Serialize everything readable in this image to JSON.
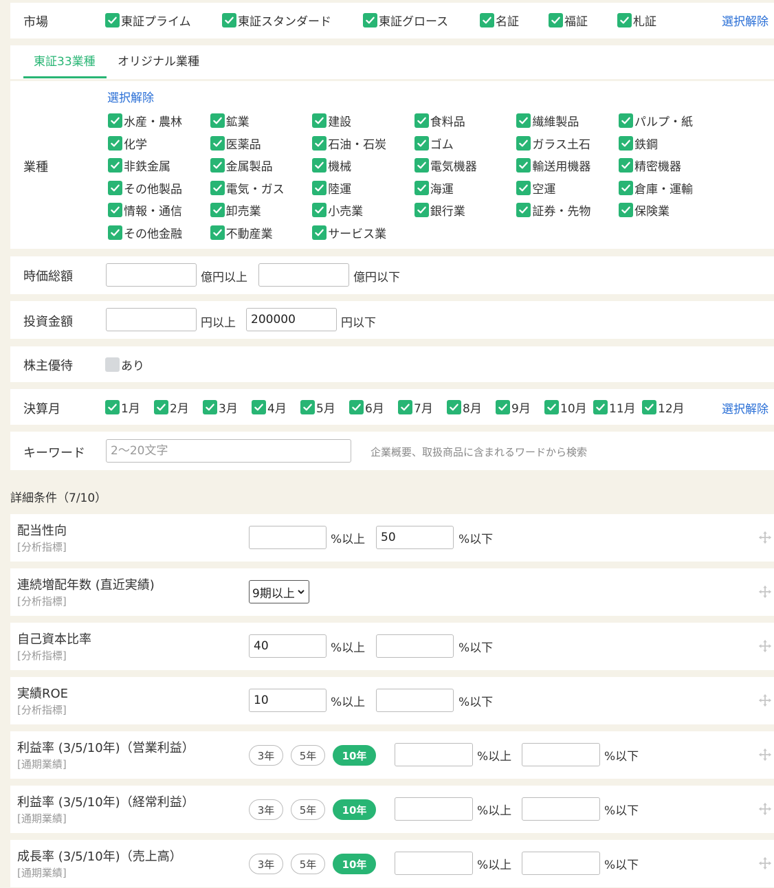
{
  "market": {
    "label": "市場",
    "items": [
      "東証プライム",
      "東証スタンダード",
      "東証グロース",
      "名証",
      "福証",
      "札証"
    ],
    "clear": "選択解除"
  },
  "tabs": [
    "東証33業種",
    "オリジナル業種"
  ],
  "industry": {
    "label": "業種",
    "clear": "選択解除",
    "items": [
      "水産・農林",
      "鉱業",
      "建設",
      "食料品",
      "繊維製品",
      "パルプ・紙",
      "化学",
      "医薬品",
      "石油・石炭",
      "ゴム",
      "ガラス土石",
      "鉄鋼",
      "非鉄金属",
      "金属製品",
      "機械",
      "電気機器",
      "輸送用機器",
      "精密機器",
      "その他製品",
      "電気・ガス",
      "陸運",
      "海運",
      "空運",
      "倉庫・運輸",
      "情報・通信",
      "卸売業",
      "小売業",
      "銀行業",
      "証券・先物",
      "保険業",
      "その他金融",
      "不動産業",
      "サービス業"
    ]
  },
  "market_cap": {
    "label": "時価総額",
    "min_value": "",
    "min_unit": "億円以上",
    "max_value": "",
    "max_unit": "億円以下"
  },
  "investment": {
    "label": "投資金額",
    "min_value": "",
    "min_unit": "円以上",
    "max_value": "200000",
    "max_unit": "円以下"
  },
  "yutai": {
    "label": "株主優待",
    "option": "あり"
  },
  "fiscal_month": {
    "label": "決算月",
    "items": [
      "1月",
      "2月",
      "3月",
      "4月",
      "5月",
      "6月",
      "7月",
      "8月",
      "9月",
      "10月",
      "11月",
      "12月"
    ],
    "clear": "選択解除"
  },
  "keyword": {
    "label": "キーワード",
    "placeholder": "2～20文字",
    "hint": "企業概要、取扱商品に含まれるワードから検索"
  },
  "details": {
    "heading": "詳細条件（7/10）",
    "conditions": [
      {
        "title": "配当性向",
        "sub": "[分析指標]",
        "min": "",
        "min_unit": "%以上",
        "max": "50",
        "max_unit": "%以下"
      },
      {
        "title": "連続増配年数 (直近実績)",
        "sub": "[分析指標]",
        "select": "9期以上"
      },
      {
        "title": "自己資本比率",
        "sub": "[分析指標]",
        "min": "40",
        "min_unit": "%以上",
        "max": "",
        "max_unit": "%以下"
      },
      {
        "title": "実績ROE",
        "sub": "[分析指標]",
        "min": "10",
        "min_unit": "%以上",
        "max": "",
        "max_unit": "%以下"
      },
      {
        "title": "利益率 (3/5/10年)（営業利益）",
        "sub": "[通期業績]",
        "periods": [
          "3年",
          "5年",
          "10年"
        ],
        "active_period": "10年",
        "min": "",
        "min_unit": "%以上",
        "max": "",
        "max_unit": "%以下"
      },
      {
        "title": "利益率 (3/5/10年)（経常利益）",
        "sub": "[通期業績]",
        "periods": [
          "3年",
          "5年",
          "10年"
        ],
        "active_period": "10年",
        "min": "",
        "min_unit": "%以上",
        "max": "",
        "max_unit": "%以下"
      },
      {
        "title": "成長率 (3/5/10年)（売上高）",
        "sub": "[通期業績]",
        "periods": [
          "3年",
          "5年",
          "10年"
        ],
        "active_period": "10年",
        "min": "",
        "min_unit": "%以上",
        "max": "",
        "max_unit": "%以下"
      }
    ]
  },
  "colors": {
    "accent": "#28b574",
    "link": "#2a6fd6",
    "background": "#f5f2e8"
  },
  "icons": {
    "check": "check-icon",
    "drag": "move-icon"
  }
}
